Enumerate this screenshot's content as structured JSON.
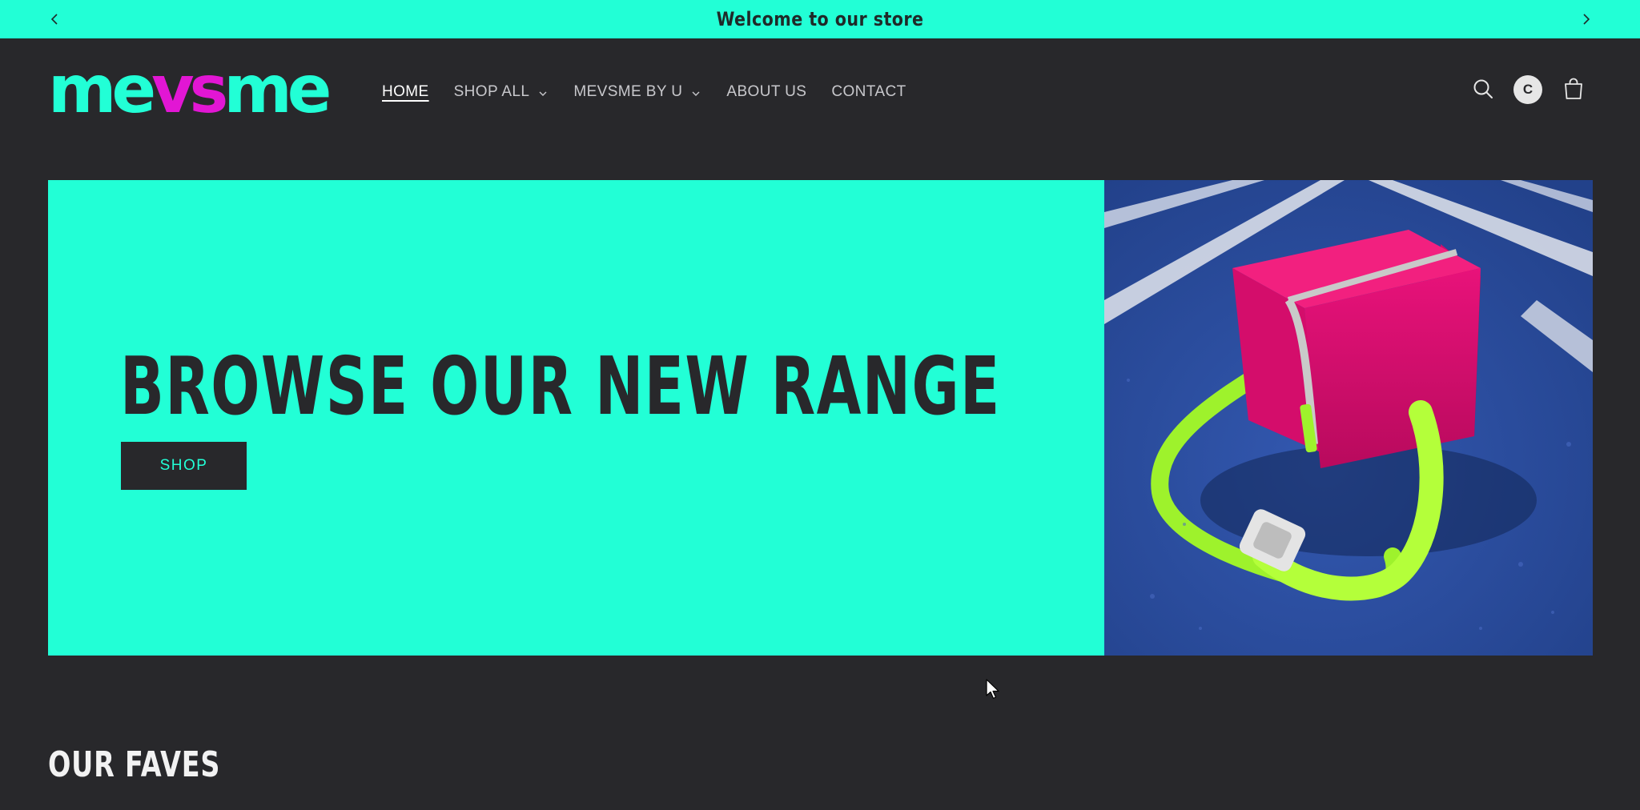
{
  "announcement": {
    "text": "Welcome to our store"
  },
  "header": {
    "logo": {
      "part1": "me",
      "part2": "vs",
      "part3": "me"
    },
    "nav": [
      {
        "label": "HOME",
        "active": true,
        "has_dropdown": false
      },
      {
        "label": "SHOP ALL",
        "active": false,
        "has_dropdown": true
      },
      {
        "label": "MEVSME BY U",
        "active": false,
        "has_dropdown": true
      },
      {
        "label": "ABOUT US",
        "active": false,
        "has_dropdown": false
      },
      {
        "label": "CONTACT",
        "active": false,
        "has_dropdown": false
      }
    ],
    "account_initial": "C",
    "icons": {
      "search": "search-icon",
      "account": "account-avatar",
      "cart": "cart-icon"
    }
  },
  "hero": {
    "heading": "BROWSE OUR NEW RANGE",
    "button_label": "SHOP",
    "image_alt": "pink-duffel-bag-on-running-track"
  },
  "sections": {
    "faves_title": "OUR FAVES"
  },
  "colors": {
    "accent": "#22ffd6",
    "background": "#28282b",
    "logo_highlight": "#e216d4",
    "text_light": "#c8c8cc"
  }
}
